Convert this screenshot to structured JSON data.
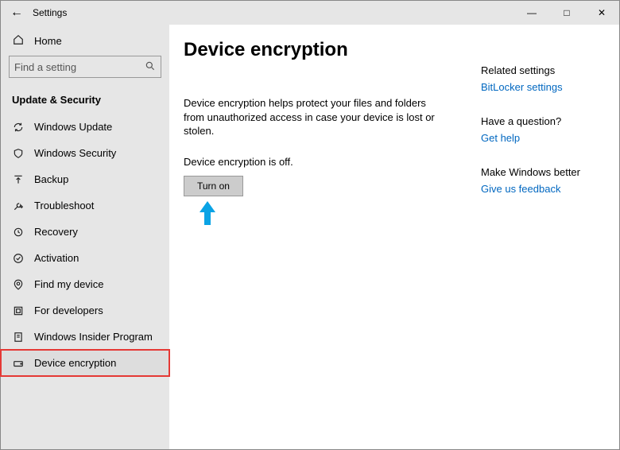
{
  "window": {
    "title": "Settings"
  },
  "sidebar": {
    "home": "Home",
    "search_placeholder": "Find a setting",
    "section": "Update & Security",
    "items": [
      {
        "label": "Windows Update",
        "icon": "sync"
      },
      {
        "label": "Windows Security",
        "icon": "shield"
      },
      {
        "label": "Backup",
        "icon": "backup"
      },
      {
        "label": "Troubleshoot",
        "icon": "wrench"
      },
      {
        "label": "Recovery",
        "icon": "recovery"
      },
      {
        "label": "Activation",
        "icon": "check"
      },
      {
        "label": "Find my device",
        "icon": "find"
      },
      {
        "label": "For developers",
        "icon": "devs"
      },
      {
        "label": "Windows Insider Program",
        "icon": "insider"
      },
      {
        "label": "Device encryption",
        "icon": "drive",
        "selected": true
      }
    ]
  },
  "content": {
    "heading": "Device encryption",
    "description": "Device encryption helps protect your files and folders from unauthorized access in case your device is lost or stolen.",
    "status": "Device encryption is off.",
    "button": "Turn on"
  },
  "rightrail": [
    {
      "title": "Related settings",
      "link": "BitLocker settings"
    },
    {
      "title": "Have a question?",
      "link": "Get help"
    },
    {
      "title": "Make Windows better",
      "link": "Give us feedback"
    }
  ]
}
